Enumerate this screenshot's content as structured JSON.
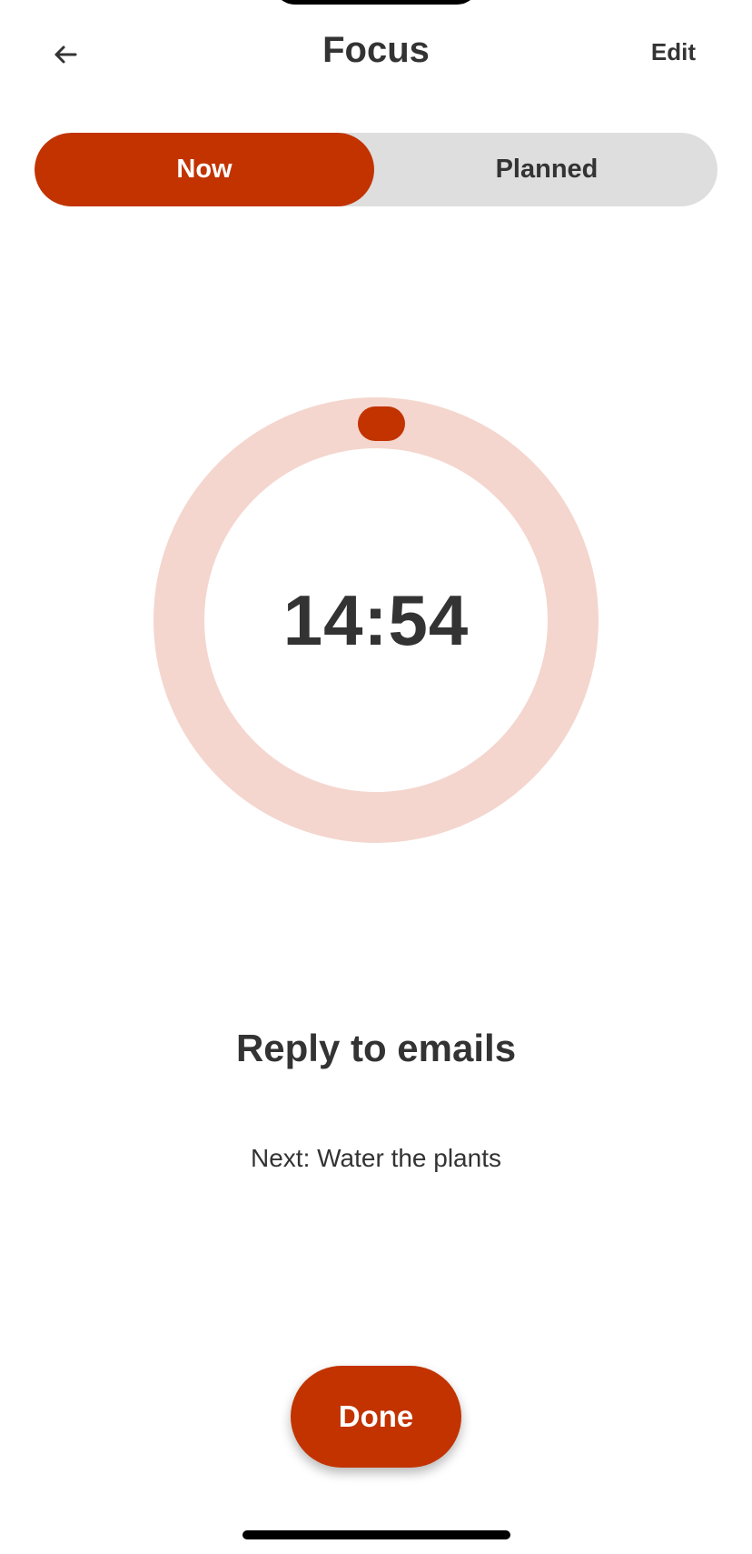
{
  "header": {
    "title": "Focus",
    "edit_label": "Edit",
    "back_icon": "arrow-left-icon"
  },
  "segmented_control": {
    "selected": "Now",
    "options": [
      {
        "label": "Now",
        "selected": true
      },
      {
        "label": "Planned",
        "selected": false
      }
    ]
  },
  "timer": {
    "display": "14:54",
    "progress_fraction": 0.0
  },
  "task": {
    "current": "Reply to emails",
    "next": "Next: Water the plants"
  },
  "actions": {
    "done_label": "Done"
  },
  "colors": {
    "accent": "#c23300",
    "ring_track": "#f4d6ce",
    "segment_bg": "#dedede",
    "text": "#333333"
  }
}
